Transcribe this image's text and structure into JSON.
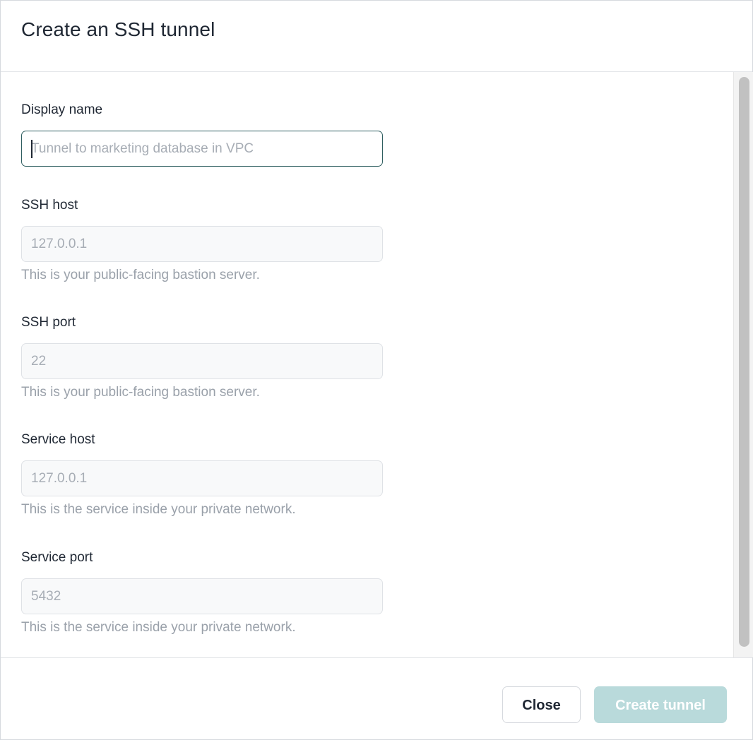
{
  "modal": {
    "title": "Create an SSH tunnel"
  },
  "fields": [
    {
      "label": "Display name",
      "placeholder": "Tunnel to marketing database in VPC",
      "value": "",
      "help": ""
    },
    {
      "label": "SSH host",
      "placeholder": "127.0.0.1",
      "value": "",
      "help": "This is your public-facing bastion server."
    },
    {
      "label": "SSH port",
      "placeholder": "22",
      "value": "",
      "help": "This is your public-facing bastion server."
    },
    {
      "label": "Service host",
      "placeholder": "127.0.0.1",
      "value": "",
      "help": "This is the service inside your private network."
    },
    {
      "label": "Service port",
      "placeholder": "5432",
      "value": "",
      "help": "This is the service inside your private network."
    }
  ],
  "footer": {
    "close_label": "Close",
    "create_label": "Create tunnel",
    "create_disabled": true
  },
  "colors": {
    "focus_border": "#2f5e60",
    "primary_disabled": "#b9dadb",
    "help_text": "#9aa1aa"
  }
}
